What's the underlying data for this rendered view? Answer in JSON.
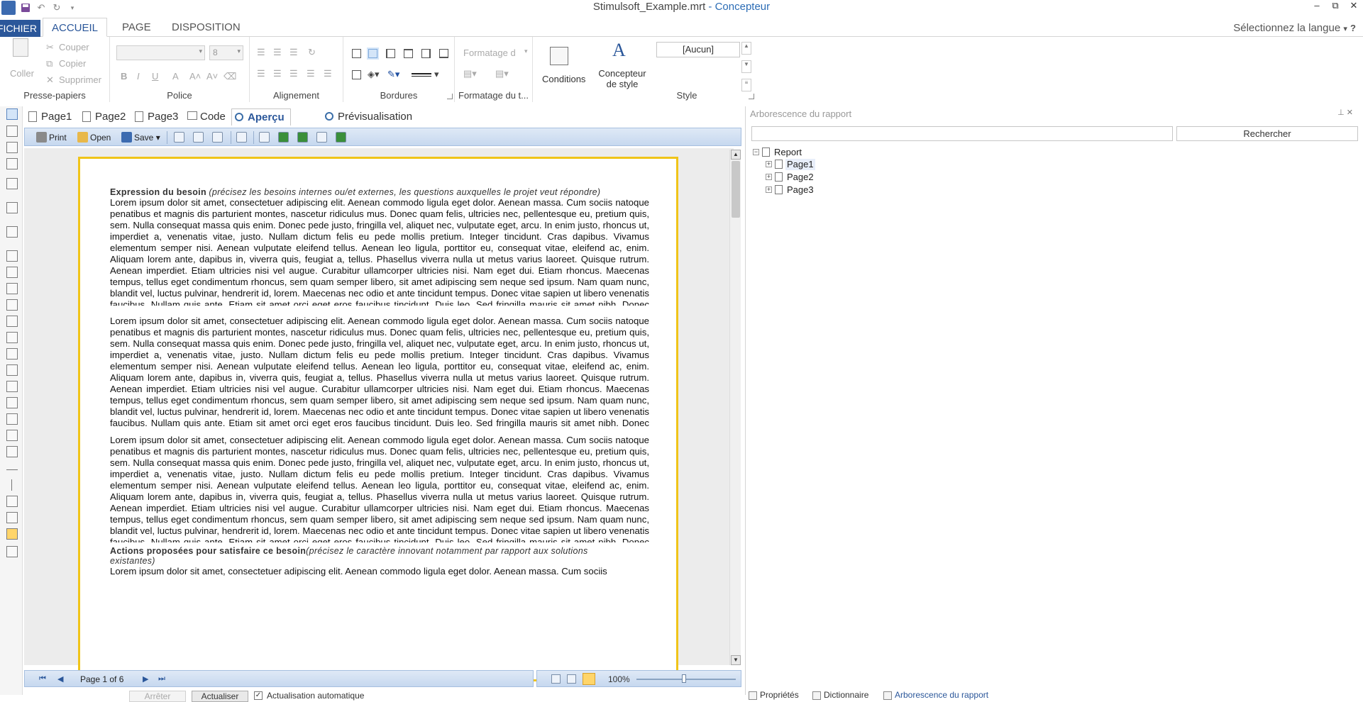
{
  "window": {
    "title": "Stimulsoft_Example.mrt",
    "subtitle": "- Concepteur"
  },
  "quick_access": {
    "undo_glyph": "↶",
    "redo_glyph": "↻",
    "dropdown_glyph": "▾"
  },
  "window_controls": {
    "minimize": "–",
    "restore": "⧉",
    "close": "✕"
  },
  "ribbon_tabs": {
    "file": "FICHIER",
    "home": "ACCUEIL",
    "page": "PAGE",
    "layout": "DISPOSITION"
  },
  "language_selector": {
    "label": "Sélectionnez la langue",
    "chevron": "▾",
    "help": "?"
  },
  "ribbon": {
    "clipboard": {
      "label": "Presse-papiers",
      "paste": "Coller",
      "cut": "Couper",
      "copy": "Copier",
      "delete": "Supprimer"
    },
    "font": {
      "label": "Police",
      "size_value": "8",
      "bold": "B",
      "italic": "I",
      "underline": "U",
      "font_color": "A",
      "grow": "A˄",
      "shrink": "A˅"
    },
    "alignment": {
      "label": "Alignement"
    },
    "borders": {
      "label": "Bordures"
    },
    "text_format": {
      "label": "Formatage du t...",
      "format_placeholder": "Formatage d"
    },
    "style": {
      "label": "Style",
      "conditions": "Conditions",
      "style_designer": "Concepteur de style",
      "style_value": "[Aucun]"
    }
  },
  "doc_tabs": [
    "Page1",
    "Page2",
    "Page3",
    "Code",
    "Aperçu Web",
    "Prévisualisation HTML"
  ],
  "viewer_toolbar": {
    "print": "Print",
    "open": "Open",
    "save": "Save"
  },
  "document": {
    "section1_title": "Expression du besoin",
    "section1_hint": "(précisez les besoins internes ou/et externes, les questions auxquelles le projet veut répondre)",
    "para1": "Lorem ipsum dolor sit amet, consectetuer adipiscing elit. Aenean commodo ligula eget dolor. Aenean massa. Cum sociis natoque penatibus et magnis dis parturient montes, nascetur ridiculus mus. Donec quam felis, ultricies nec, pellentesque eu, pretium quis, sem. Nulla consequat massa quis enim. Donec pede justo, fringilla vel, aliquet nec, vulputate eget, arcu. In enim justo, rhoncus ut, imperdiet a, venenatis vitae, justo. Nullam dictum felis eu pede mollis pretium. Integer tincidunt. Cras dapibus. Vivamus elementum semper nisi. Aenean vulputate eleifend tellus. Aenean leo ligula, porttitor eu, consequat vitae, eleifend ac, enim. Aliquam lorem ante, dapibus in, viverra quis, feugiat a, tellus. Phasellus viverra nulla ut metus varius laoreet. Quisque rutrum. Aenean imperdiet. Etiam ultricies nisi vel augue. Curabitur ullamcorper ultricies nisi. Nam eget dui. Etiam rhoncus. Maecenas tempus, tellus eget condimentum rhoncus, sem quam semper libero, sit amet adipiscing sem neque sed ipsum. Nam quam nunc, blandit vel, luctus pulvinar, hendrerit id, lorem. Maecenas nec odio et ante tincidunt tempus. Donec vitae sapien ut libero venenatis faucibus. Nullam quis ante. Etiam sit amet orci eget eros faucibus tincidunt. Duis leo. Sed fringilla mauris sit amet nibh. Donec sodales sagittis magna. Sed consequat, leo eget bibendum sodales, augue velit cursus nunc,",
    "section2_title": "Actions proposées pour satisfaire ce besoin",
    "section2_hint": "(précisez le caractère innovant notamment par rapport aux solutions existantes)",
    "para_partial": "Lorem ipsum dolor sit amet, consectetuer adipiscing elit. Aenean commodo ligula eget dolor. Aenean massa. Cum sociis"
  },
  "navigation": {
    "page_label": "Page 1 of 6",
    "first": "⏮",
    "prev": "◀",
    "next": "▶",
    "last": "⏭"
  },
  "zoom": {
    "value": "100%",
    "level_fraction": 0.5
  },
  "bottom_controls": {
    "stop": "Arrêter",
    "refresh": "Actualiser",
    "auto_refresh": "Actualisation automatique"
  },
  "report_tree": {
    "title": "Arborescence du rapport",
    "search_button": "Rechercher",
    "root": "Report",
    "pages": [
      "Page1",
      "Page2",
      "Page3"
    ]
  },
  "right_bottom_tabs": [
    "Propriétés",
    "Dictionnaire",
    "Arborescence du rapport"
  ],
  "colors": {
    "accent": "#2b579a",
    "page_border": "#f0c419",
    "toolbar": "#c6d8ef"
  }
}
